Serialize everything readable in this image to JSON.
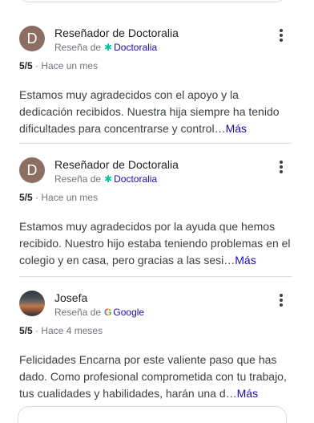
{
  "reviews": [
    {
      "avatar_letter": "D",
      "name": "Reseñador de Doctoralia",
      "source_prefix": "Reseña de",
      "source_icon": "doctoralia-logo-icon",
      "source_name": "Doctoralia",
      "rating": "5/5",
      "time": "Hace un mes",
      "text": "Estamos muy agradecidos con el apoyo y la dedicación recibidos. Nuestra hija siempre ha tenido dificultades para concentrarse y control…",
      "more_label": "Más"
    },
    {
      "avatar_letter": "D",
      "name": "Reseñador de Doctoralia",
      "source_prefix": "Reseña de",
      "source_icon": "doctoralia-logo-icon",
      "source_name": "Doctoralia",
      "rating": "5/5",
      "time": "Hace un mes",
      "text": "Estamos muy agradecidos por la ayuda que hemos recibido. Nuestro hijo estaba teniendo problemas en el colegio y en casa, pero gracias a las sesi…",
      "more_label": "Más"
    },
    {
      "avatar_letter": "",
      "name": "Josefa",
      "source_prefix": "Reseña de",
      "source_icon": "google-logo-icon",
      "source_name": "Google",
      "rating": "5/5",
      "time": "Hace 4 meses",
      "text": "Felicidades Encarna por este valiente paso que has dado. Como profesional comprometida con tu trabajo, tus cualidades y habilidades, harán una d…",
      "more_label": "Más"
    }
  ],
  "separator": "·",
  "colors": {
    "doctoralia_teal": "#00c3a5",
    "link_blue": "#1a0dab",
    "avatar_brown": "#8d6e63",
    "divider": "#dadce0"
  }
}
